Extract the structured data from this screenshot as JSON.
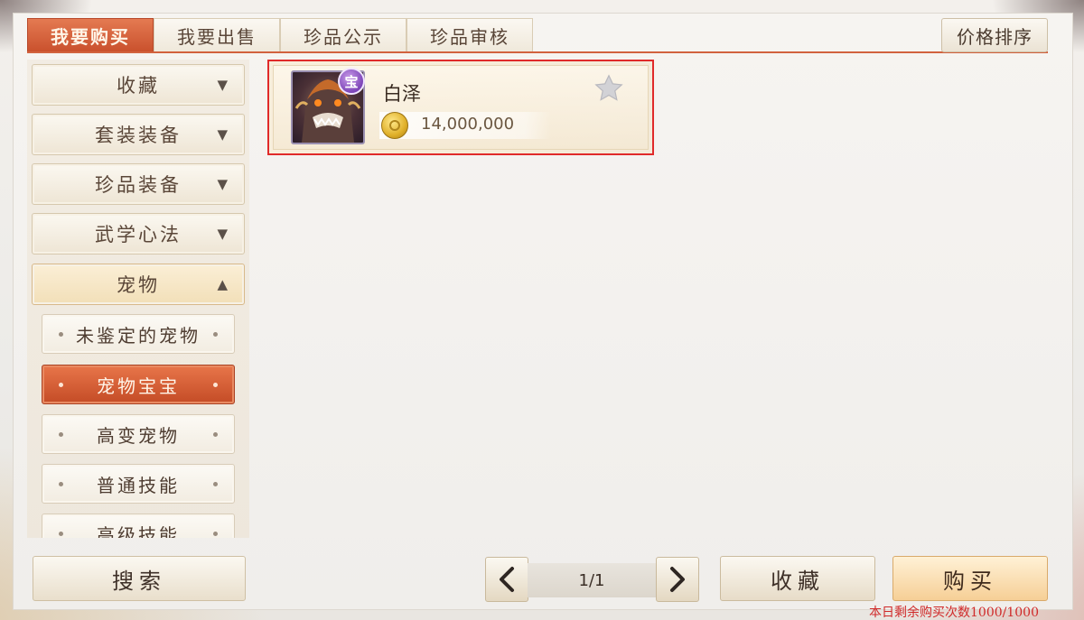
{
  "tabs": [
    {
      "label": "我要购买",
      "active": true
    },
    {
      "label": "我要出售",
      "active": false
    },
    {
      "label": "珍品公示",
      "active": false
    },
    {
      "label": "珍品审核",
      "active": false
    }
  ],
  "sort_button": "价格排序",
  "sidebar": {
    "categories": [
      {
        "label": "收藏",
        "arrow": "▼"
      },
      {
        "label": "套装装备",
        "arrow": "▼"
      },
      {
        "label": "珍品装备",
        "arrow": "▼"
      },
      {
        "label": "武学心法",
        "arrow": "▼"
      },
      {
        "label": "宠物",
        "arrow": "▲"
      }
    ],
    "subitems": [
      {
        "label": "未鉴定的宠物"
      },
      {
        "label": "宠物宝宝"
      },
      {
        "label": "高变宠物"
      },
      {
        "label": "普通技能"
      },
      {
        "label": "高级技能"
      }
    ]
  },
  "search_button": "搜索",
  "listing": {
    "name": "白泽",
    "badge": "宝",
    "price": "14,000,000",
    "icons": {
      "portrait": "baize-portrait-icon",
      "currency": "gold-coin-icon",
      "favorite": "star-icon"
    }
  },
  "pagination": {
    "page": "1/1",
    "prev_icon": "chevron-left-icon",
    "next_icon": "chevron-right-icon"
  },
  "favorite_button": "收藏",
  "buy_button": "购买",
  "quota_text": "本日剩余购买次数1000/1000",
  "colors": {
    "accent": "#d2623e",
    "selection": "#e02a2a",
    "quota": "#d02a2a"
  }
}
